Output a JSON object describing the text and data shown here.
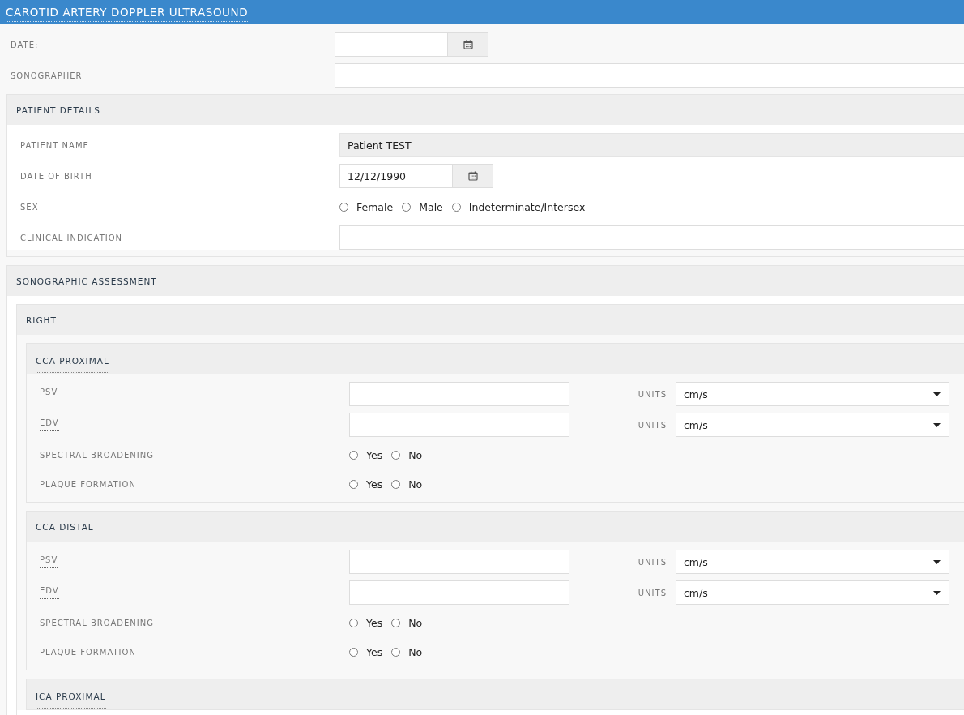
{
  "header": {
    "title": "CAROTID ARTERY DOPPLER ULTRASOUND"
  },
  "fields": [
    {
      "label": "DATE:",
      "kind": "date"
    },
    {
      "label": "SONOGRAPHER",
      "kind": "text"
    }
  ],
  "patient_details": {
    "title": "PATIENT DETAILS",
    "fields": [
      {
        "label": "PATIENT NAME",
        "kind": "readonly",
        "value": "Patient TEST"
      },
      {
        "label": "DATE OF BIRTH",
        "kind": "date",
        "value": "12/12/1990"
      },
      {
        "label": "SEX",
        "kind": "radio",
        "options": [
          {
            "label": "Female",
            "selected": false
          },
          {
            "label": "Male",
            "selected": false
          },
          {
            "label": "Indeterminate/Intersex",
            "selected": false
          }
        ]
      },
      {
        "label": "CLINICAL INDICATION",
        "kind": "text"
      }
    ]
  },
  "sonographic_assessment": {
    "title": "SONOGRAPHIC ASSESSMENT",
    "sides": [
      {
        "title": "RIGHT",
        "segments": [
          {
            "title": "CCA PROXIMAL",
            "dotted_underline": true,
            "rows": [
              {
                "label": "PSV",
                "kind": "measure",
                "dotted_underline": true,
                "units_label": "UNITS",
                "units": "cm/s"
              },
              {
                "label": "EDV",
                "kind": "measure",
                "dotted_underline": true,
                "units_label": "UNITS",
                "units": "cm/s"
              },
              {
                "label": "SPECTRAL BROADENING",
                "kind": "radio",
                "options": [
                  {
                    "label": "Yes",
                    "selected": false
                  },
                  {
                    "label": "No",
                    "selected": false
                  }
                ]
              },
              {
                "label": "PLAQUE FORMATION",
                "kind": "radio",
                "options": [
                  {
                    "label": "Yes",
                    "selected": false
                  },
                  {
                    "label": "No",
                    "selected": false
                  }
                ]
              }
            ]
          },
          {
            "title": "CCA DISTAL",
            "dotted_underline": false,
            "rows": [
              {
                "label": "PSV",
                "kind": "measure",
                "dotted_underline": true,
                "units_label": "UNITS",
                "units": "cm/s"
              },
              {
                "label": "EDV",
                "kind": "measure",
                "dotted_underline": true,
                "units_label": "UNITS",
                "units": "cm/s"
              },
              {
                "label": "SPECTRAL BROADENING",
                "kind": "radio",
                "options": [
                  {
                    "label": "Yes",
                    "selected": false
                  },
                  {
                    "label": "No",
                    "selected": false
                  }
                ]
              },
              {
                "label": "PLAQUE FORMATION",
                "kind": "radio",
                "options": [
                  {
                    "label": "Yes",
                    "selected": false
                  },
                  {
                    "label": "No",
                    "selected": false
                  }
                ]
              }
            ]
          },
          {
            "title": "ICA PROXIMAL",
            "dotted_underline": true
          }
        ]
      }
    ]
  }
}
